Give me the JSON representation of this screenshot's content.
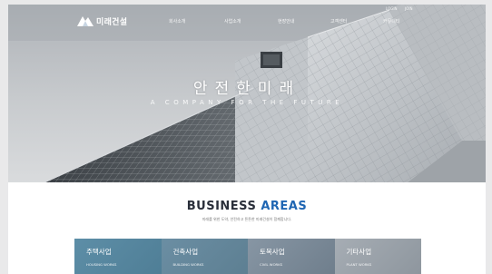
{
  "header": {
    "logo_text": "미래건설",
    "nav": [
      "회사소개",
      "사업소개",
      "현장안내",
      "고객센터",
      "커뮤니티"
    ],
    "util": [
      "LOGIN",
      "JOIN"
    ]
  },
  "hero": {
    "title": "안전한미래",
    "subtitle": "A COMPANY FOR THE FUTURE"
  },
  "business": {
    "title_part1": "BUSINESS",
    "title_part2": "AREAS",
    "description": "미래를 위한 도약, 안전하고 튼튼한 미래건설이 함께합니다.",
    "cards": [
      {
        "title": "주택사업",
        "subtitle": "HOUSING WORKS"
      },
      {
        "title": "건축사업",
        "subtitle": "BUILDING WORKS"
      },
      {
        "title": "토목사업",
        "subtitle": "CIVIL WORKS"
      },
      {
        "title": "기타사업",
        "subtitle": "PLANT WORKS"
      }
    ]
  },
  "colors": {
    "accent": "#1f66b3",
    "heading": "#2a2f3a",
    "card_bg": "#5f8fa8"
  }
}
